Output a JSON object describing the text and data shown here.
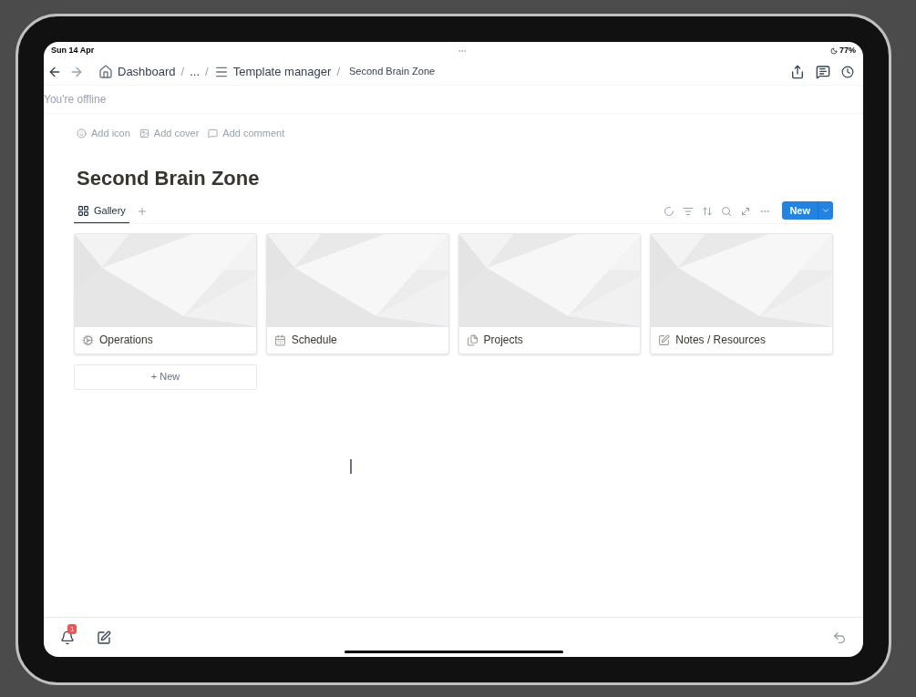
{
  "status_bar": {
    "date": "Sun 14 Apr",
    "battery": "77%"
  },
  "breadcrumbs": [
    {
      "label": "Dashboard",
      "kind": "home"
    },
    {
      "separator": "/",
      "label": "...",
      "kind": "plain"
    },
    {
      "separator": "/",
      "label": "Template manager",
      "kind": "list"
    },
    {
      "separator": "/",
      "label": "Second Brain Zone",
      "kind": "current"
    }
  ],
  "offline_banner": "You're offline",
  "page_actions": [
    "Add icon",
    "Add cover",
    "Add comment"
  ],
  "title": "Second Brain Zone",
  "views": [
    {
      "label": "Gallery",
      "selected": true
    }
  ],
  "new_button": "New",
  "cards": [
    {
      "title": "Operations"
    },
    {
      "title": "Schedule"
    },
    {
      "title": "Projects"
    },
    {
      "title": "Notes / Resources"
    }
  ],
  "new_card": "+ New",
  "bottom_bar": {
    "notification_count": "1"
  }
}
